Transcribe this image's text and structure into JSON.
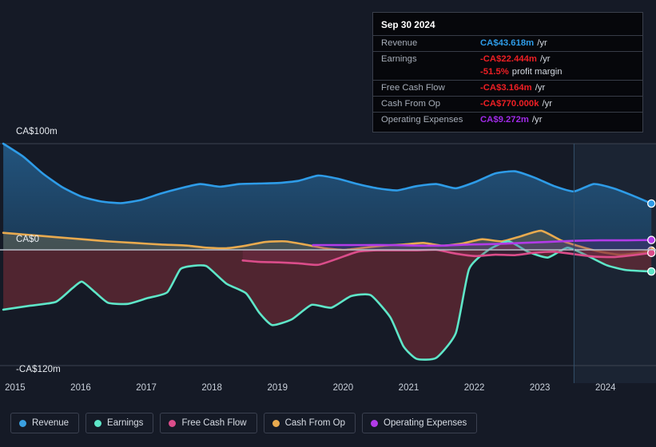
{
  "theme": {
    "background": "#151a26",
    "gridline": "#3c4350",
    "zero_line": "#b9bfc9",
    "forecast_band": "#1b2433"
  },
  "tooltip": {
    "date": "Sep 30 2024",
    "rows": [
      {
        "name": "Revenue",
        "value": "CA$43.618m",
        "unit": "/yr",
        "color": "#2e9ce8"
      },
      {
        "name": "Earnings",
        "value": "-CA$22.444m",
        "unit": "/yr",
        "color": "#ef1f24"
      },
      {
        "name": "",
        "value": "-51.5%",
        "unit": "profit margin",
        "color": "#ef1f24"
      },
      {
        "name": "Free Cash Flow",
        "value": "-CA$3.164m",
        "unit": "/yr",
        "color": "#ef1f24"
      },
      {
        "name": "Cash From Op",
        "value": "-CA$770.000k",
        "unit": "/yr",
        "color": "#ef1f24"
      },
      {
        "name": "Operating Expenses",
        "value": "CA$9.272m",
        "unit": "/yr",
        "color": "#a02ae8"
      }
    ]
  },
  "legend": {
    "items": [
      {
        "label": "Revenue",
        "color": "#3aa0e0"
      },
      {
        "label": "Earnings",
        "color": "#5ee6c8"
      },
      {
        "label": "Free Cash Flow",
        "color": "#db4d8a"
      },
      {
        "label": "Cash From Op",
        "color": "#e8aa4f"
      },
      {
        "label": "Operating Expenses",
        "color": "#b23be8"
      }
    ]
  },
  "chart_data": {
    "type": "area",
    "title": "",
    "xlabel": "",
    "ylabel": "",
    "currency": "CA$",
    "ylim": [
      -120,
      100
    ],
    "y_ticks": [
      100,
      0,
      -120
    ],
    "y_tick_labels": [
      "CA$100m",
      "CA$0",
      "-CA$120m"
    ],
    "grid": true,
    "legend_position": "bottom",
    "x_ticks": [
      2015,
      2016,
      2017,
      2018,
      2019,
      2020,
      2021,
      2022,
      2023,
      2024
    ],
    "x_tick_labels": [
      "2015",
      "2016",
      "2017",
      "2018",
      "2019",
      "2020",
      "2021",
      "2022",
      "2023",
      "2024"
    ],
    "xlim": [
      2014.85,
      2024.85
    ],
    "forecast_start": 2023.6,
    "series": [
      {
        "name": "Revenue",
        "color": "#2e9ce8",
        "fill": "rgba(36,98,150,0.55)",
        "x": [
          2014.9,
          2015.2,
          2015.5,
          2015.8,
          2016.1,
          2016.4,
          2016.7,
          2017.0,
          2017.3,
          2017.6,
          2017.9,
          2018.2,
          2018.5,
          2018.8,
          2019.1,
          2019.4,
          2019.7,
          2020.0,
          2020.3,
          2020.6,
          2020.9,
          2021.2,
          2021.5,
          2021.8,
          2022.1,
          2022.4,
          2022.7,
          2023.0,
          2023.3,
          2023.6,
          2023.9,
          2024.2,
          2024.5,
          2024.78
        ],
        "values": [
          100.0,
          88.0,
          72.0,
          59.0,
          50.0,
          45.5,
          44.0,
          47.0,
          53.0,
          58.0,
          62.0,
          59.5,
          62.0,
          62.5,
          63.0,
          65.0,
          70.0,
          67.0,
          62.0,
          58.0,
          56.0,
          60.0,
          62.0,
          58.0,
          64.0,
          72.0,
          74.0,
          68.0,
          60.0,
          55.0,
          62.0,
          58.0,
          51.0,
          43.618
        ]
      },
      {
        "name": "Earnings",
        "color": "#5ee6c8",
        "fill": "rgba(120,45,55,0.6)",
        "x": [
          2014.9,
          2015.3,
          2015.7,
          2015.95,
          2016.1,
          2016.3,
          2016.5,
          2016.8,
          2017.1,
          2017.4,
          2017.6,
          2017.8,
          2018.0,
          2018.3,
          2018.6,
          2018.8,
          2019.0,
          2019.3,
          2019.6,
          2019.9,
          2020.2,
          2020.5,
          2020.8,
          2021.0,
          2021.2,
          2021.5,
          2021.8,
          2022.0,
          2022.3,
          2022.6,
          2022.9,
          2023.2,
          2023.5,
          2023.8,
          2024.1,
          2024.4,
          2024.78
        ],
        "values": [
          -62.0,
          -58.0,
          -54.0,
          -40.0,
          -33.0,
          -44.0,
          -55.0,
          -56.0,
          -50.0,
          -44.0,
          -20.0,
          -16.5,
          -17.0,
          -35.0,
          -45.0,
          -65.0,
          -78.0,
          -72.0,
          -57.0,
          -60.0,
          -48.0,
          -47.0,
          -70.0,
          -100.0,
          -113.0,
          -112.0,
          -86.0,
          -20.0,
          0.0,
          8.0,
          -2.0,
          -8.0,
          2.0,
          -6.0,
          -16.0,
          -21.0,
          -22.444
        ]
      },
      {
        "name": "Free Cash Flow",
        "color": "#db4d8a",
        "fill": "rgba(140,50,85,0.30)",
        "start_x": 2018.55,
        "x": [
          2018.55,
          2018.8,
          2019.1,
          2019.4,
          2019.7,
          2020.0,
          2020.3,
          2020.6,
          2020.9,
          2021.2,
          2021.5,
          2021.8,
          2022.1,
          2022.4,
          2022.7,
          2023.0,
          2023.3,
          2023.6,
          2023.9,
          2024.2,
          2024.5,
          2024.78
        ],
        "values": [
          -11.0,
          -12.5,
          -13.0,
          -14.0,
          -15.5,
          -9.0,
          -2.0,
          -0.5,
          -0.5,
          -0.5,
          0.0,
          -4.0,
          -6.5,
          -5.0,
          -5.5,
          -3.0,
          -2.0,
          -4.5,
          -7.0,
          -7.5,
          -5.5,
          -3.164
        ]
      },
      {
        "name": "Cash From Op",
        "color": "#e8aa4f",
        "fill": "rgba(120,110,80,0.45)",
        "x": [
          2014.9,
          2015.3,
          2015.7,
          2016.1,
          2016.5,
          2016.9,
          2017.3,
          2017.7,
          2018.0,
          2018.3,
          2018.6,
          2018.9,
          2019.2,
          2019.5,
          2019.8,
          2020.1,
          2020.4,
          2020.7,
          2021.0,
          2021.3,
          2021.6,
          2021.9,
          2022.2,
          2022.5,
          2022.8,
          2023.1,
          2023.4,
          2023.7,
          2024.0,
          2024.3,
          2024.6,
          2024.78
        ],
        "values": [
          16.0,
          14.0,
          12.0,
          10.0,
          8.0,
          6.5,
          5.0,
          4.0,
          2.0,
          1.5,
          4.0,
          7.5,
          8.0,
          5.0,
          1.5,
          0.0,
          2.0,
          4.0,
          5.0,
          6.5,
          4.0,
          6.0,
          10.0,
          8.0,
          13.0,
          18.0,
          9.0,
          3.0,
          -2.0,
          -5.0,
          -3.0,
          -0.77
        ]
      },
      {
        "name": "Operating Expenses",
        "color": "#b23be8",
        "fill": "rgba(100,40,140,0.28)",
        "start_x": 2019.62,
        "x": [
          2019.62,
          2020.0,
          2020.4,
          2020.8,
          2021.2,
          2021.6,
          2022.0,
          2022.4,
          2022.8,
          2023.2,
          2023.6,
          2024.0,
          2024.4,
          2024.78
        ],
        "values": [
          4.5,
          4.5,
          4.5,
          4.5,
          4.0,
          4.0,
          5.0,
          5.5,
          6.5,
          7.5,
          8.5,
          9.0,
          9.0,
          9.272
        ]
      }
    ]
  }
}
